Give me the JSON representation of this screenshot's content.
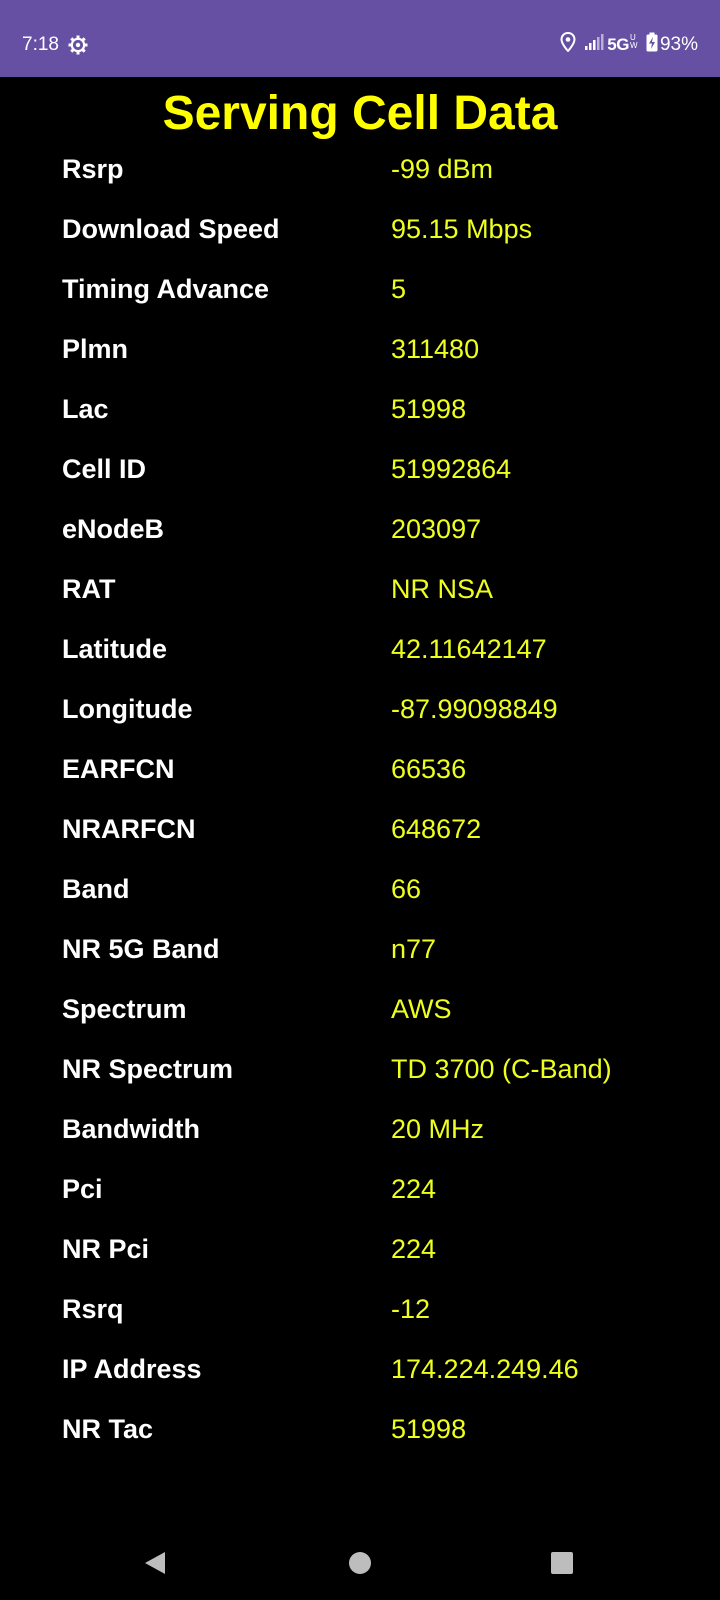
{
  "status_bar": {
    "time": "7:18",
    "settings_icon": "gear-icon",
    "location_icon": "location-pin-icon",
    "signal_icon": "cell-signal-icon",
    "network_type": "5G",
    "network_sub": "UW",
    "battery_icon": "battery-charging-icon",
    "battery_percent": "93%",
    "background_color": "#6650a4"
  },
  "title": "Serving Cell Data",
  "title_color": "#ffff00",
  "value_color": "#eeff1f",
  "rows": [
    {
      "label": "Rsrp",
      "value": "-99 dBm"
    },
    {
      "label": "Download Speed",
      "value": "95.15 Mbps"
    },
    {
      "label": "Timing Advance",
      "value": "5"
    },
    {
      "label": "Plmn",
      "value": "311480"
    },
    {
      "label": "Lac",
      "value": "51998"
    },
    {
      "label": "Cell ID",
      "value": "51992864"
    },
    {
      "label": "eNodeB",
      "value": "203097"
    },
    {
      "label": "RAT",
      "value": "NR NSA"
    },
    {
      "label": "Latitude",
      "value": "42.11642147"
    },
    {
      "label": "Longitude",
      "value": "-87.99098849"
    },
    {
      "label": "EARFCN",
      "value": "66536"
    },
    {
      "label": "NRARFCN",
      "value": "648672"
    },
    {
      "label": "Band",
      "value": "66"
    },
    {
      "label": "NR 5G Band",
      "value": "n77"
    },
    {
      "label": "Spectrum",
      "value": "AWS"
    },
    {
      "label": "NR Spectrum",
      "value": "TD 3700 (C-Band)"
    },
    {
      "label": "Bandwidth",
      "value": "20 MHz"
    },
    {
      "label": "Pci",
      "value": "224"
    },
    {
      "label": "NR Pci",
      "value": "224"
    },
    {
      "label": "Rsrq",
      "value": "-12"
    },
    {
      "label": "IP Address",
      "value": "174.224.249.46"
    },
    {
      "label": "NR Tac",
      "value": "51998"
    }
  ],
  "nav_bar": {
    "back_icon": "back-triangle-icon",
    "home_icon": "home-circle-icon",
    "recents_icon": "recents-square-icon"
  }
}
